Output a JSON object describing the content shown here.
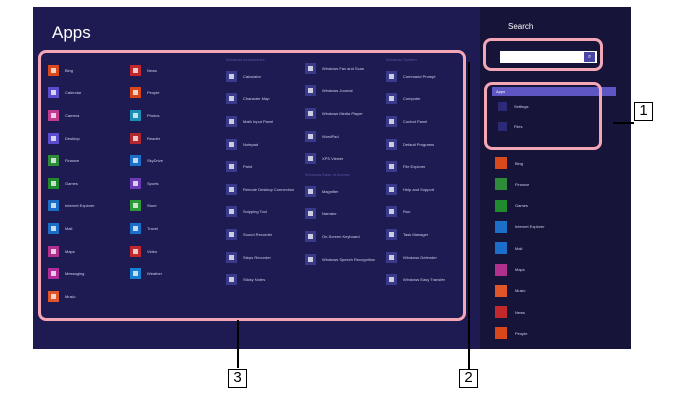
{
  "apps_title": "Apps",
  "columns": [
    {
      "items": [
        {
          "label": "Bing",
          "color": "#d84a1b"
        },
        {
          "label": "Calendar",
          "color": "#5a4ccf"
        },
        {
          "label": "Camera",
          "color": "#c23b8e"
        },
        {
          "label": "Desktop",
          "color": "#5a4ccf"
        },
        {
          "label": "Finance",
          "color": "#2e8b3a"
        },
        {
          "label": "Games",
          "color": "#1f8a2e"
        },
        {
          "label": "Internet Explorer",
          "color": "#1b6fc9"
        },
        {
          "label": "Mail",
          "color": "#1b6fc9"
        },
        {
          "label": "Maps",
          "color": "#b0318d"
        },
        {
          "label": "Messaging",
          "color": "#b02a9a"
        },
        {
          "label": "Music",
          "color": "#e0562a"
        }
      ]
    },
    {
      "items": [
        {
          "label": "News",
          "color": "#c0282e"
        },
        {
          "label": "People",
          "color": "#d8471b"
        },
        {
          "label": "Photos",
          "color": "#1b8fb5"
        },
        {
          "label": "Reader",
          "color": "#b0282e"
        },
        {
          "label": "SkyDrive",
          "color": "#1b6fc9"
        },
        {
          "label": "Sports",
          "color": "#6b3ab7"
        },
        {
          "label": "Store",
          "color": "#2e9a3a"
        },
        {
          "label": "Travel",
          "color": "#1b6fc9"
        },
        {
          "label": "Video",
          "color": "#c0282e"
        },
        {
          "label": "Weather",
          "color": "#1b7fd1"
        }
      ]
    },
    {
      "group": "Windows Accessories",
      "items": [
        {
          "label": "Calculator",
          "color": "#3a3a8a"
        },
        {
          "label": "Character Map",
          "color": "#3a3a8a"
        },
        {
          "label": "Math Input Panel",
          "color": "#3a3a8a"
        },
        {
          "label": "Notepad",
          "color": "#3a3a8a"
        },
        {
          "label": "Paint",
          "color": "#3a3a8a"
        },
        {
          "label": "Remote Desktop Connection",
          "color": "#3a3a8a"
        },
        {
          "label": "Snipping Tool",
          "color": "#3a3a8a"
        },
        {
          "label": "Sound Recorder",
          "color": "#3a3a8a"
        },
        {
          "label": "Steps Recorder",
          "color": "#3a3a8a"
        },
        {
          "label": "Sticky Notes",
          "color": "#3a3a8a"
        }
      ]
    },
    {
      "items": [
        {
          "label": "Windows Fax and Scan",
          "color": "#3a3a8a"
        },
        {
          "label": "Windows Journal",
          "color": "#3a3a8a"
        },
        {
          "label": "Windows Media Player",
          "color": "#3a3a8a"
        },
        {
          "label": "WordPad",
          "color": "#3a3a8a"
        },
        {
          "label": "XPS Viewer",
          "color": "#3a3a8a"
        }
      ],
      "group2": "Windows Ease of Access",
      "items2": [
        {
          "label": "Magnifier",
          "color": "#3a3a8a"
        },
        {
          "label": "Narrator",
          "color": "#3a3a8a"
        },
        {
          "label": "On-Screen Keyboard",
          "color": "#3a3a8a"
        },
        {
          "label": "Windows Speech Recognition",
          "color": "#3a3a8a"
        }
      ]
    },
    {
      "group": "Windows System",
      "items": [
        {
          "label": "Command Prompt",
          "color": "#3a3a8a"
        },
        {
          "label": "Computer",
          "color": "#3a3a8a"
        },
        {
          "label": "Control Panel",
          "color": "#3a3a8a"
        },
        {
          "label": "Default Programs",
          "color": "#3a3a8a"
        },
        {
          "label": "File Explorer",
          "color": "#3a3a8a"
        },
        {
          "label": "Help and Support",
          "color": "#3a3a8a"
        },
        {
          "label": "Run",
          "color": "#3a3a8a"
        },
        {
          "label": "Task Manager",
          "color": "#3a3a8a"
        },
        {
          "label": "Windows Defender",
          "color": "#3a3a8a"
        },
        {
          "label": "Windows Easy Transfer",
          "color": "#3a3a8a"
        }
      ]
    }
  ],
  "search": {
    "title": "Search",
    "value": "",
    "go_glyph": "⌕",
    "apps_label": "Apps",
    "scopes": [
      {
        "label": "Settings",
        "glyph": "✲"
      },
      {
        "label": "Files",
        "glyph": "▤"
      }
    ],
    "apps": [
      {
        "label": "Bing",
        "color": "#d84a1b"
      },
      {
        "label": "Finance",
        "color": "#2e8b3a"
      },
      {
        "label": "Games",
        "color": "#1f8a2e"
      },
      {
        "label": "Internet Explorer",
        "color": "#1b6fc9"
      },
      {
        "label": "Mail",
        "color": "#1b6fc9"
      },
      {
        "label": "Maps",
        "color": "#b0318d"
      },
      {
        "label": "Music",
        "color": "#e0562a"
      },
      {
        "label": "News",
        "color": "#c0282e"
      },
      {
        "label": "People",
        "color": "#d8471b"
      }
    ]
  },
  "callouts": [
    "1",
    "2",
    "3"
  ]
}
